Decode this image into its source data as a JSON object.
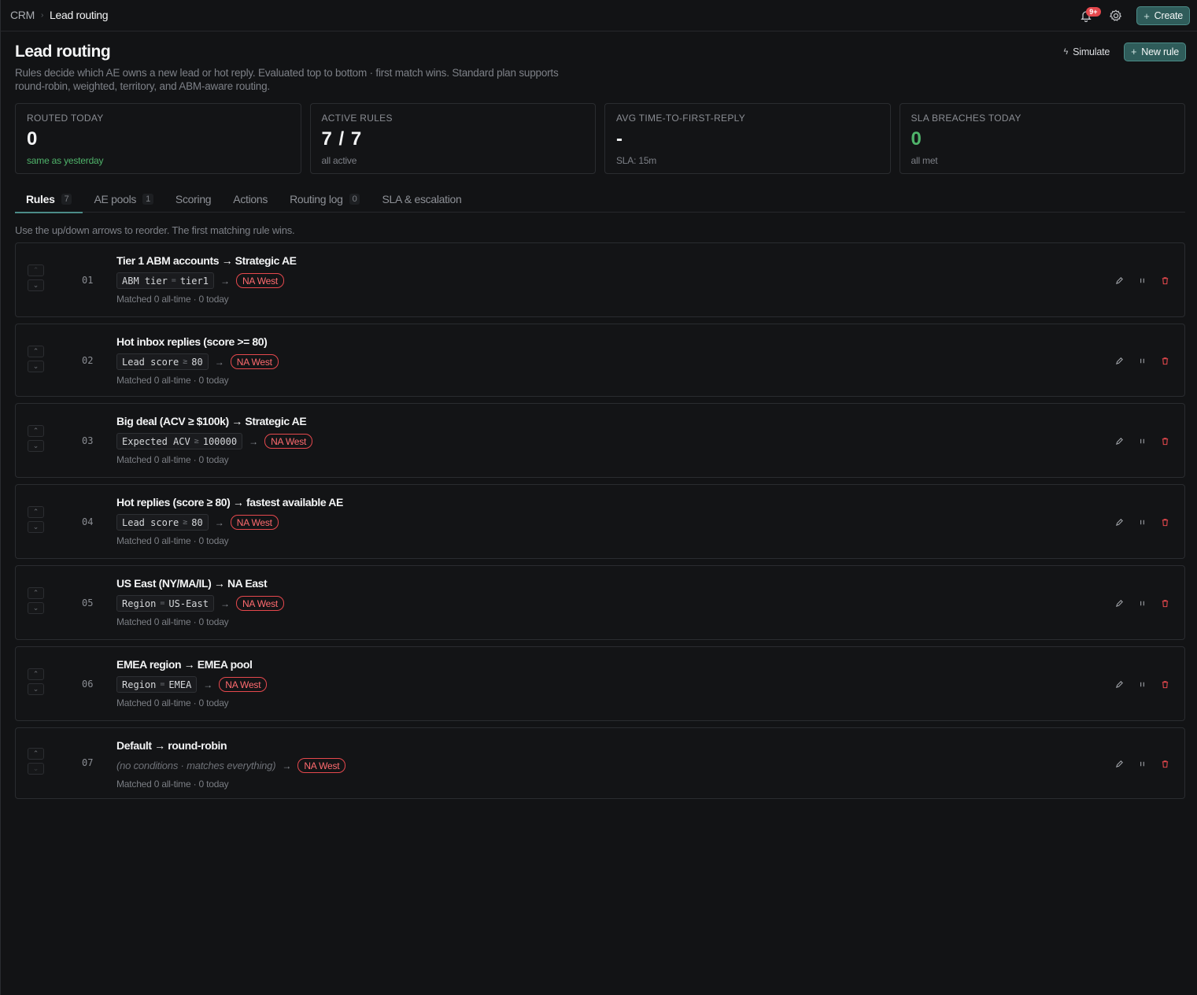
{
  "breadcrumb": {
    "root": "CRM",
    "separator": "›",
    "current": "Lead routing"
  },
  "topbar": {
    "notification_badge": "9+",
    "create_label": "Create",
    "create_icon": "+"
  },
  "header": {
    "title": "Lead routing",
    "description": "Rules decide which AE owns a new lead or hot reply. Evaluated top to bottom · first match wins. Standard plan supports round-robin, weighted, territory, and ABM-aware routing.",
    "simulate_label": "Simulate",
    "new_rule_label": "New rule"
  },
  "stats": [
    {
      "label": "ROUTED TODAY",
      "value": "0",
      "sub": "same as yesterday"
    },
    {
      "label": "ACTIVE RULES",
      "value": "7 / 7",
      "sub": "all active"
    },
    {
      "label": "AVG TIME-TO-FIRST-REPLY",
      "value": "-",
      "sub": "SLA: 15m"
    },
    {
      "label": "SLA BREACHES TODAY",
      "value": "0",
      "sub": "all met"
    }
  ],
  "tabs": [
    {
      "label": "Rules",
      "count": "7"
    },
    {
      "label": "AE pools",
      "count": "1"
    },
    {
      "label": "Scoring"
    },
    {
      "label": "Actions"
    },
    {
      "label": "Routing log",
      "count": "0"
    },
    {
      "label": "SLA & escalation"
    }
  ],
  "hint": "Use the up/down arrows to reorder. The first matching rule wins.",
  "rules": [
    {
      "num": "01",
      "name": "Tier 1 ABM accounts → Strategic AE",
      "field": "ABM tier",
      "op": "=",
      "value": "tier1",
      "target": "NA West",
      "meta": "Matched 0 all-time · 0 today"
    },
    {
      "num": "02",
      "name": "Hot inbox replies (score >= 80)",
      "field": "Lead score",
      "op": "≥",
      "value": "80",
      "target": "NA West",
      "meta": "Matched 0 all-time · 0 today"
    },
    {
      "num": "03",
      "name": "Big deal (ACV ≥ $100k) → Strategic AE",
      "field": "Expected ACV",
      "op": "≥",
      "value": "100000",
      "target": "NA West",
      "meta": "Matched 0 all-time · 0 today"
    },
    {
      "num": "04",
      "name": "Hot replies (score ≥ 80) → fastest available AE",
      "field": "Lead score",
      "op": "≥",
      "value": "80",
      "target": "NA West",
      "meta": "Matched 0 all-time · 0 today"
    },
    {
      "num": "05",
      "name": "US East (NY/MA/IL) → NA East",
      "field": "Region",
      "op": "=",
      "value": "US-East",
      "target": "NA West",
      "meta": "Matched 0 all-time · 0 today"
    },
    {
      "num": "06",
      "name": "EMEA region → EMEA pool",
      "field": "Region",
      "op": "=",
      "value": "EMEA",
      "target": "NA West",
      "meta": "Matched 0 all-time · 0 today"
    },
    {
      "num": "07",
      "name": "Default → round-robin",
      "no_conditions": "(no conditions · matches everything)",
      "target": "NA West",
      "meta": "Matched 0 all-time · 0 today"
    }
  ],
  "arrow_symbol": "→",
  "colors": {
    "accent": "#2f5c5a",
    "danger": "#e5484d",
    "success": "#4fb36a",
    "background": "#121315"
  },
  "icons": [
    "bell-icon",
    "gear-icon",
    "bolt-icon",
    "chevron-up-icon",
    "chevron-down-icon",
    "pencil-icon",
    "pause-icon",
    "trash-icon"
  ]
}
